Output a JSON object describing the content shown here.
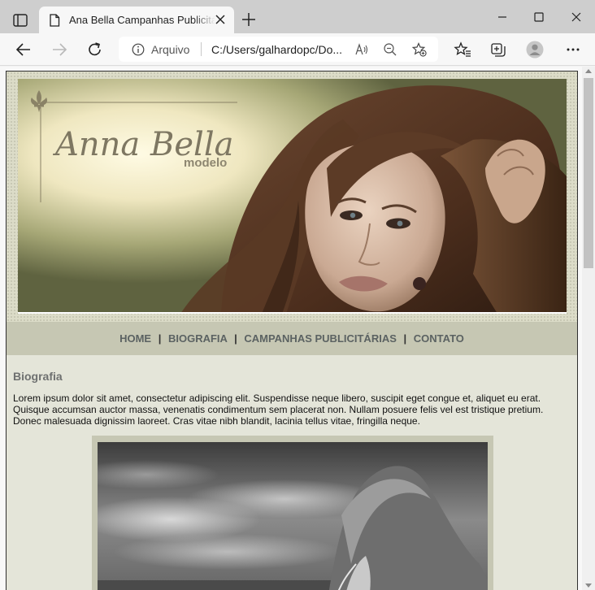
{
  "browser": {
    "tab": {
      "title": "Ana Bella Campanhas Publicitárias"
    },
    "address": {
      "protocol_label": "Arquivo",
      "url": "C:/Users/galhardopc/Do..."
    }
  },
  "page": {
    "stray_char": "<",
    "brand": {
      "name": "Anna Bella",
      "tagline": "modelo"
    },
    "nav": {
      "items": [
        "HOME",
        "BIOGRAFIA",
        "CAMPANHAS PUBLICITÁRIAS",
        "CONTATO"
      ],
      "separator": "|"
    },
    "content": {
      "title": "Biografia",
      "lines": [
        "Lorem ipsum dolor sit amet, consectetur adipiscing elit. Suspendisse neque libero, suscipit eget congue et, aliquet eu erat.",
        "Quisque accumsan auctor massa, venenatis condimentum sem placerat non. Nullam posuere felis vel est tristique pretium.",
        "Donec malesuada dignissim laoreet. Cras vitae nibh blandit, lacinia tellus vitae, fringilla neque."
      ]
    }
  },
  "colors": {
    "site_bg": "#e4e5d9",
    "nav_bg": "#c6c7b3",
    "nav_text": "#5b6262",
    "title_text": "#6e7070"
  },
  "icons": [
    "tab-actions-icon",
    "page-icon",
    "close-icon",
    "plus-icon",
    "minimize-icon",
    "maximize-icon",
    "close-window-icon",
    "back-arrow-icon",
    "forward-arrow-icon",
    "reload-icon",
    "info-icon",
    "read-aloud-icon",
    "zoom-out-icon",
    "add-favorite-icon",
    "favorites-icon",
    "collections-icon",
    "profile-icon",
    "more-icon"
  ]
}
